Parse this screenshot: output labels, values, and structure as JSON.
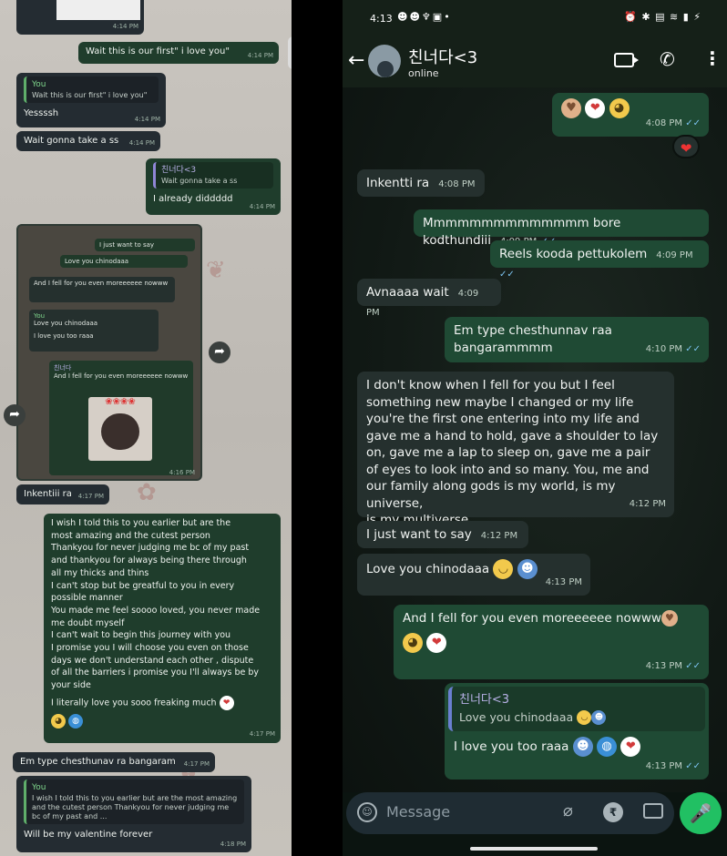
{
  "left": {
    "bubbles": [
      {
        "text": "Wait this is our first\" i love you\"",
        "time": "4:14 PM"
      },
      {
        "quote_name": "You",
        "quote_text": "Wait this is our first\" i love you\"",
        "text": "Yessssh",
        "time": "4:14 PM"
      },
      {
        "text": "Wait gonna take a ss",
        "time": "4:14 PM"
      },
      {
        "quote_name": "친너다<3",
        "quote_text": "Wait gonna take a ss",
        "text": "I already diddddd",
        "time": "4:14 PM"
      },
      {
        "text": "Inkentiii ra",
        "time": "4:17 PM"
      },
      {
        "text": "Em type chesthunav ra bangaram",
        "time": "4:17 PM"
      },
      {
        "quote_name": "You",
        "quote_text": "I wish I told this to you earlier but are the most amazing and the cutest person Thankyou for never judging me bc of my past and ...",
        "text": "Will be my valentine forever",
        "time": "4:18 PM"
      }
    ],
    "long_message": {
      "lines": [
        "I wish I told this to you earlier but are the",
        "most amazing and the cutest person",
        "Thankyou for never judging me bc of my past",
        "and thankyou for always being there through",
        "all my thicks and thins",
        "I can't stop but be greatful to you in every",
        "possible manner",
        "You made me feel soooo loved, you never made",
        "me doubt myself",
        "I can't wait to begin this journey with you",
        "I promise you I will choose you even on those",
        "days we don't understand each other , dispute",
        "of all the barriers i promise you I'll always be by",
        "your side",
        "I literally love you sooo freaking much"
      ],
      "time": "4:17 PM"
    },
    "screenshot": {
      "lines": [
        "I just want to say",
        "Love you chinodaaa",
        "And I fell for you even moreeeeee nowww",
        "You",
        "Love you chinodaaa",
        "I love you too raaa",
        "친너다",
        "And I fell for you even moreeeeee nowww"
      ],
      "time": "4:16 PM"
    }
  },
  "status_bar": {
    "time": "4:13"
  },
  "header": {
    "contact_name": "친너다<3",
    "status": "online"
  },
  "messages": [
    {
      "text": "Inkentti ra",
      "time": "4:08 PM"
    },
    {
      "text": "Mmmmmmmmmmmmmm bore kodthundiii",
      "time": "4:09 PM"
    },
    {
      "text": "Reels kooda pettukolem",
      "time": "4:09 PM"
    },
    {
      "text": "Avnaaaa wait",
      "time": "4:09 PM"
    },
    {
      "text": "Em type chesthunnav raa bangarammmm",
      "time": "4:10 PM"
    },
    {
      "text": "I just want to say",
      "time": "4:12 PM"
    },
    {
      "text": "Love you chinodaaa",
      "time": "4:13 PM"
    },
    {
      "text": "And I fell for you even moreeeeee nowww",
      "time": "4:13 PM"
    },
    {
      "quote_name": "친너다<3",
      "quote_text": "Love you chinodaaa",
      "text": "I love you too raaa",
      "time": "4:13 PM"
    }
  ],
  "emoji_bubble_time": "4:08 PM",
  "long_incoming": {
    "lines": [
      "I don't know when I fell for you but I feel",
      "something new maybe I changed or my life",
      "you're the first one entering into my life and",
      "gave me a hand to hold, gave a shoulder to lay",
      "on, gave me a lap to sleep on, gave me a pair",
      "of eyes to look into and so many. You, me and",
      "our family along gods is my world, is my universe,",
      "is my multiverse"
    ],
    "time": "4:12 PM"
  },
  "composer": {
    "placeholder": "Message"
  },
  "colors": {
    "outgoing": "#1f4a34",
    "incoming": "#25302e",
    "header": "#152018",
    "accent": "#21c063"
  }
}
